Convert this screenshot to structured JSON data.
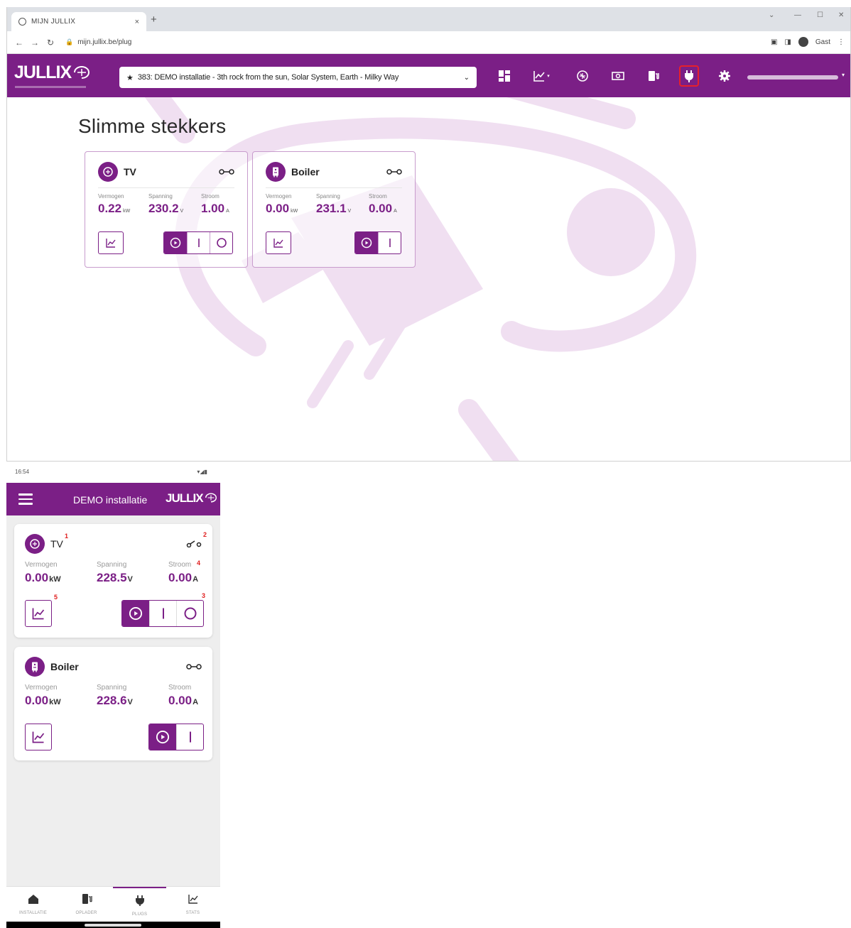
{
  "desktop": {
    "tab_title": "MIJN JULLIX",
    "tab_close": "×",
    "new_tab": "+",
    "url": "mijn.jullix.be/plug",
    "guest_label": "Gast",
    "logo": "JULLIX",
    "installation_select": "383: DEMO installatie - 3th rock from the sun, Solar System, Earth - Milky Way",
    "nav_icons": [
      "dashboard-icon",
      "chart-icon",
      "brain-icon",
      "money-icon",
      "charger-icon",
      "plug-icon",
      "gear-icon"
    ],
    "active_nav": "plug-icon",
    "page_title": "Slimme stekkers",
    "cards": [
      {
        "name": "TV",
        "icon": "brain-icon",
        "labels": {
          "power": "Vermogen",
          "voltage": "Spanning",
          "current": "Stroom"
        },
        "power": "0.22",
        "power_unit": "kW",
        "voltage": "230.2",
        "voltage_unit": "V",
        "current": "1.00",
        "current_unit": "A",
        "modes": [
          "auto",
          "on",
          "off"
        ],
        "active_mode": "auto"
      },
      {
        "name": "Boiler",
        "icon": "boiler-icon",
        "labels": {
          "power": "Vermogen",
          "voltage": "Spanning",
          "current": "Stroom"
        },
        "power": "0.00",
        "power_unit": "kW",
        "voltage": "231.1",
        "voltage_unit": "V",
        "current": "0.00",
        "current_unit": "A",
        "modes": [
          "auto",
          "on"
        ],
        "active_mode": "auto"
      }
    ]
  },
  "mobile": {
    "status_time": "16:54",
    "title": "DEMO installatie",
    "logo": "JULLIX",
    "cards": [
      {
        "name": "TV",
        "labels": {
          "power": "Vermogen",
          "voltage": "Spanning",
          "current": "Stroom"
        },
        "power": "0.00",
        "power_unit": "kW",
        "voltage": "228.5",
        "voltage_unit": "V",
        "current": "0.00",
        "current_unit": "A",
        "annotations": [
          "1",
          "2",
          "3",
          "4",
          "5"
        ]
      },
      {
        "name": "Boiler",
        "labels": {
          "power": "Vermogen",
          "voltage": "Spanning",
          "current": "Stroom"
        },
        "power": "0.00",
        "power_unit": "kW",
        "voltage": "228.6",
        "voltage_unit": "V",
        "current": "0.00",
        "current_unit": "A"
      }
    ],
    "bottom_nav": [
      {
        "label": "INSTALLATIE",
        "icon": "house-icon"
      },
      {
        "label": "OPLADER",
        "icon": "charger-icon"
      },
      {
        "label": "PLUGS",
        "icon": "plug-icon"
      },
      {
        "label": "STATS",
        "icon": "chart-icon"
      }
    ],
    "active_bottom": "PLUGS"
  },
  "colors": {
    "brand": "#7b1f86",
    "brand_light": "#c89ccd",
    "active_outline": "#e8202a"
  }
}
